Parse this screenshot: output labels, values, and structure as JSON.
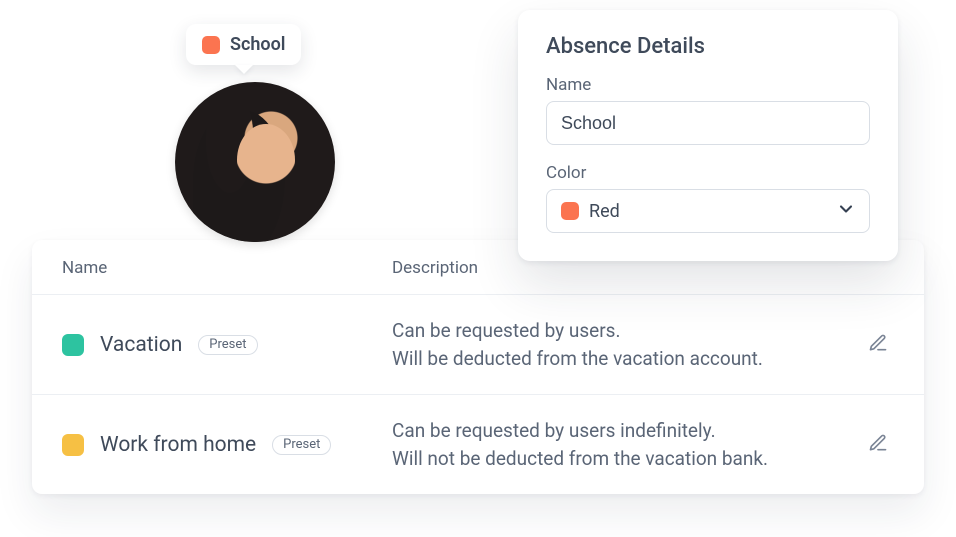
{
  "tooltip": {
    "label": "School",
    "color": "#fb7450"
  },
  "details": {
    "title": "Absence Details",
    "name_label": "Name",
    "name_value": "School",
    "color_label": "Color",
    "color_value": "Red",
    "color_hex": "#fb7450"
  },
  "table": {
    "headers": {
      "name": "Name",
      "description": "Description"
    },
    "preset_label": "Preset",
    "rows": [
      {
        "color": "#2dc3a0",
        "name": "Vacation",
        "preset": true,
        "desc_line1": "Can be requested by users.",
        "desc_line2": "Will be deducted from the vacation account."
      },
      {
        "color": "#f6c044",
        "name": "Work from home",
        "preset": true,
        "desc_line1": "Can be requested by users indefinitely.",
        "desc_line2": "Will not be deducted from the vacation bank."
      }
    ]
  }
}
